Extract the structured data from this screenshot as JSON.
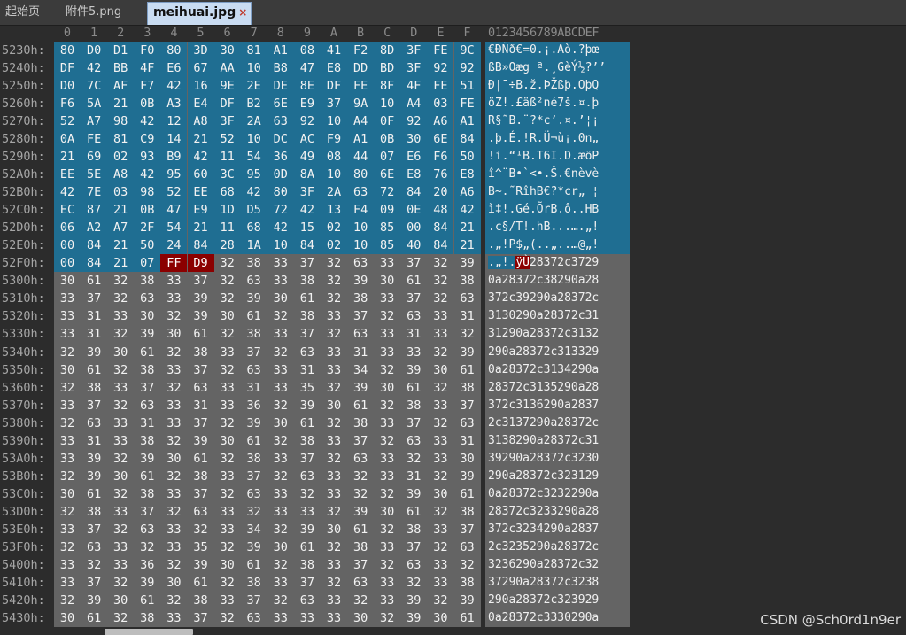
{
  "tabs": [
    {
      "label": "起始页",
      "active": false
    },
    {
      "label": "附件5.png",
      "active": false
    },
    {
      "label": "meihuai.jpg",
      "active": true,
      "close": "×"
    }
  ],
  "column_headers": [
    "0",
    "1",
    "2",
    "3",
    "4",
    "5",
    "6",
    "7",
    "8",
    "9",
    "A",
    "B",
    "C",
    "D",
    "E",
    "F"
  ],
  "ascii_header": "0123456789ABCDEF",
  "colors": {
    "selection": "#1f6e92",
    "marker": "#8b0000",
    "panel": "#646464",
    "background": "#2c2c2c"
  },
  "rows": [
    {
      "addr": "5230h:",
      "bytes": [
        "80",
        "D0",
        "D1",
        "F0",
        "80",
        "3D",
        "30",
        "81",
        "A1",
        "08",
        "41",
        "F2",
        "8D",
        "3F",
        "FE",
        "9C"
      ],
      "ascii": "€ÐÑð€=0.¡.Aò.?þœ",
      "state": "sel"
    },
    {
      "addr": "5240h:",
      "bytes": [
        "DF",
        "42",
        "BB",
        "4F",
        "E6",
        "67",
        "AA",
        "10",
        "B8",
        "47",
        "E8",
        "DD",
        "BD",
        "3F",
        "92",
        "92"
      ],
      "ascii": "ßB»Oæg ª.¸GèÝ½?’’",
      "state": "sel"
    },
    {
      "addr": "5250h:",
      "bytes": [
        "D0",
        "7C",
        "AF",
        "F7",
        "42",
        "16",
        "9E",
        "2E",
        "DE",
        "8E",
        "DF",
        "FE",
        "8F",
        "4F",
        "FE",
        "51"
      ],
      "ascii": "Ð|¯÷B.ž.ÞŽßþ.OþQ",
      "state": "sel"
    },
    {
      "addr": "5260h:",
      "bytes": [
        "F6",
        "5A",
        "21",
        "0B",
        "A3",
        "E4",
        "DF",
        "B2",
        "6E",
        "E9",
        "37",
        "9A",
        "10",
        "A4",
        "03",
        "FE"
      ],
      "ascii": "öZ!.£äß²né7š.¤.þ",
      "state": "sel"
    },
    {
      "addr": "5270h:",
      "bytes": [
        "52",
        "A7",
        "98",
        "42",
        "12",
        "A8",
        "3F",
        "2A",
        "63",
        "92",
        "10",
        "A4",
        "0F",
        "92",
        "A6",
        "A1"
      ],
      "ascii": "R§˜B.¨?*c’.¤.’¦¡",
      "state": "sel"
    },
    {
      "addr": "5280h:",
      "bytes": [
        "0A",
        "FE",
        "81",
        "C9",
        "14",
        "21",
        "52",
        "10",
        "DC",
        "AC",
        "F9",
        "A1",
        "0B",
        "30",
        "6E",
        "84"
      ],
      "ascii": ".þ.É.!R.Ü¬ù¡.0n„",
      "state": "sel"
    },
    {
      "addr": "5290h:",
      "bytes": [
        "21",
        "69",
        "02",
        "93",
        "B9",
        "42",
        "11",
        "54",
        "36",
        "49",
        "08",
        "44",
        "07",
        "E6",
        "F6",
        "50"
      ],
      "ascii": "!i.“¹B.T6I.D.æöP",
      "state": "sel"
    },
    {
      "addr": "52A0h:",
      "bytes": [
        "EE",
        "5E",
        "A8",
        "42",
        "95",
        "60",
        "3C",
        "95",
        "0D",
        "8A",
        "10",
        "80",
        "6E",
        "E8",
        "76",
        "E8"
      ],
      "ascii": "î^¨B•`<•.Š.€nèvè",
      "state": "sel"
    },
    {
      "addr": "52B0h:",
      "bytes": [
        "42",
        "7E",
        "03",
        "98",
        "52",
        "EE",
        "68",
        "42",
        "80",
        "3F",
        "2A",
        "63",
        "72",
        "84",
        "20",
        "A6"
      ],
      "ascii": "B~.˜RîhB€?*cr„ ¦",
      "state": "sel"
    },
    {
      "addr": "52C0h:",
      "bytes": [
        "EC",
        "87",
        "21",
        "0B",
        "47",
        "E9",
        "1D",
        "D5",
        "72",
        "42",
        "13",
        "F4",
        "09",
        "0E",
        "48",
        "42"
      ],
      "ascii": "ì‡!.Gé.ÕrB.ô..HB",
      "state": "sel"
    },
    {
      "addr": "52D0h:",
      "bytes": [
        "06",
        "A2",
        "A7",
        "2F",
        "54",
        "21",
        "11",
        "68",
        "42",
        "15",
        "02",
        "10",
        "85",
        "00",
        "84",
        "21"
      ],
      "ascii": ".¢§/T!.hB...….„!",
      "state": "sel"
    },
    {
      "addr": "52E0h:",
      "bytes": [
        "00",
        "84",
        "21",
        "50",
        "24",
        "84",
        "28",
        "1A",
        "10",
        "84",
        "02",
        "10",
        "85",
        "40",
        "84",
        "21"
      ],
      "ascii": ".„!P$„(..„..…@„!",
      "state": "sel"
    },
    {
      "addr": "52F0h:",
      "bytes": [
        "00",
        "84",
        "21",
        "07",
        "FF",
        "D9",
        "32",
        "38",
        "33",
        "37",
        "32",
        "63",
        "33",
        "37",
        "32",
        "39"
      ],
      "ascii_sel": ".„!.",
      "ascii_mark": "ÿÙ",
      "ascii_rest": "28372c3729",
      "state": "split"
    },
    {
      "addr": "5300h:",
      "bytes": [
        "30",
        "61",
        "32",
        "38",
        "33",
        "37",
        "32",
        "63",
        "33",
        "38",
        "32",
        "39",
        "30",
        "61",
        "32",
        "38"
      ],
      "ascii": "0a28372c38290a28",
      "state": "gray"
    },
    {
      "addr": "5310h:",
      "bytes": [
        "33",
        "37",
        "32",
        "63",
        "33",
        "39",
        "32",
        "39",
        "30",
        "61",
        "32",
        "38",
        "33",
        "37",
        "32",
        "63"
      ],
      "ascii": "372c39290a28372c",
      "state": "gray"
    },
    {
      "addr": "5320h:",
      "bytes": [
        "33",
        "31",
        "33",
        "30",
        "32",
        "39",
        "30",
        "61",
        "32",
        "38",
        "33",
        "37",
        "32",
        "63",
        "33",
        "31"
      ],
      "ascii": "3130290a28372c31",
      "state": "gray"
    },
    {
      "addr": "5330h:",
      "bytes": [
        "33",
        "31",
        "32",
        "39",
        "30",
        "61",
        "32",
        "38",
        "33",
        "37",
        "32",
        "63",
        "33",
        "31",
        "33",
        "32"
      ],
      "ascii": "31290a28372c3132",
      "state": "gray"
    },
    {
      "addr": "5340h:",
      "bytes": [
        "32",
        "39",
        "30",
        "61",
        "32",
        "38",
        "33",
        "37",
        "32",
        "63",
        "33",
        "31",
        "33",
        "33",
        "32",
        "39"
      ],
      "ascii": "290a28372c313329",
      "state": "gray"
    },
    {
      "addr": "5350h:",
      "bytes": [
        "30",
        "61",
        "32",
        "38",
        "33",
        "37",
        "32",
        "63",
        "33",
        "31",
        "33",
        "34",
        "32",
        "39",
        "30",
        "61"
      ],
      "ascii": "0a28372c3134290a",
      "state": "gray"
    },
    {
      "addr": "5360h:",
      "bytes": [
        "32",
        "38",
        "33",
        "37",
        "32",
        "63",
        "33",
        "31",
        "33",
        "35",
        "32",
        "39",
        "30",
        "61",
        "32",
        "38"
      ],
      "ascii": "28372c3135290a28",
      "state": "gray"
    },
    {
      "addr": "5370h:",
      "bytes": [
        "33",
        "37",
        "32",
        "63",
        "33",
        "31",
        "33",
        "36",
        "32",
        "39",
        "30",
        "61",
        "32",
        "38",
        "33",
        "37"
      ],
      "ascii": "372c3136290a2837",
      "state": "gray"
    },
    {
      "addr": "5380h:",
      "bytes": [
        "32",
        "63",
        "33",
        "31",
        "33",
        "37",
        "32",
        "39",
        "30",
        "61",
        "32",
        "38",
        "33",
        "37",
        "32",
        "63"
      ],
      "ascii": "2c3137290a28372c",
      "state": "gray"
    },
    {
      "addr": "5390h:",
      "bytes": [
        "33",
        "31",
        "33",
        "38",
        "32",
        "39",
        "30",
        "61",
        "32",
        "38",
        "33",
        "37",
        "32",
        "63",
        "33",
        "31"
      ],
      "ascii": "3138290a28372c31",
      "state": "gray"
    },
    {
      "addr": "53A0h:",
      "bytes": [
        "33",
        "39",
        "32",
        "39",
        "30",
        "61",
        "32",
        "38",
        "33",
        "37",
        "32",
        "63",
        "33",
        "32",
        "33",
        "30"
      ],
      "ascii": "39290a28372c3230",
      "state": "gray"
    },
    {
      "addr": "53B0h:",
      "bytes": [
        "32",
        "39",
        "30",
        "61",
        "32",
        "38",
        "33",
        "37",
        "32",
        "63",
        "33",
        "32",
        "33",
        "31",
        "32",
        "39"
      ],
      "ascii": "290a28372c323129",
      "state": "gray"
    },
    {
      "addr": "53C0h:",
      "bytes": [
        "30",
        "61",
        "32",
        "38",
        "33",
        "37",
        "32",
        "63",
        "33",
        "32",
        "33",
        "32",
        "32",
        "39",
        "30",
        "61"
      ],
      "ascii": "0a28372c3232290a",
      "state": "gray"
    },
    {
      "addr": "53D0h:",
      "bytes": [
        "32",
        "38",
        "33",
        "37",
        "32",
        "63",
        "33",
        "32",
        "33",
        "33",
        "32",
        "39",
        "30",
        "61",
        "32",
        "38"
      ],
      "ascii": "28372c3233290a28",
      "state": "gray"
    },
    {
      "addr": "53E0h:",
      "bytes": [
        "33",
        "37",
        "32",
        "63",
        "33",
        "32",
        "33",
        "34",
        "32",
        "39",
        "30",
        "61",
        "32",
        "38",
        "33",
        "37"
      ],
      "ascii": "372c3234290a2837",
      "state": "gray"
    },
    {
      "addr": "53F0h:",
      "bytes": [
        "32",
        "63",
        "33",
        "32",
        "33",
        "35",
        "32",
        "39",
        "30",
        "61",
        "32",
        "38",
        "33",
        "37",
        "32",
        "63"
      ],
      "ascii": "2c3235290a28372c",
      "state": "gray"
    },
    {
      "addr": "5400h:",
      "bytes": [
        "33",
        "32",
        "33",
        "36",
        "32",
        "39",
        "30",
        "61",
        "32",
        "38",
        "33",
        "37",
        "32",
        "63",
        "33",
        "32"
      ],
      "ascii": "3236290a28372c32",
      "state": "gray"
    },
    {
      "addr": "5410h:",
      "bytes": [
        "33",
        "37",
        "32",
        "39",
        "30",
        "61",
        "32",
        "38",
        "33",
        "37",
        "32",
        "63",
        "33",
        "32",
        "33",
        "38"
      ],
      "ascii": "37290a28372c3238",
      "state": "gray"
    },
    {
      "addr": "5420h:",
      "bytes": [
        "32",
        "39",
        "30",
        "61",
        "32",
        "38",
        "33",
        "37",
        "32",
        "63",
        "33",
        "32",
        "33",
        "39",
        "32",
        "39"
      ],
      "ascii": "290a28372c323929",
      "state": "gray"
    },
    {
      "addr": "5430h:",
      "bytes": [
        "30",
        "61",
        "32",
        "38",
        "33",
        "37",
        "32",
        "63",
        "33",
        "33",
        "33",
        "30",
        "32",
        "39",
        "30",
        "61"
      ],
      "ascii": "0a28372c3330290a",
      "state": "gray"
    }
  ],
  "watermark": "CSDN @Sch0rd1n9er"
}
